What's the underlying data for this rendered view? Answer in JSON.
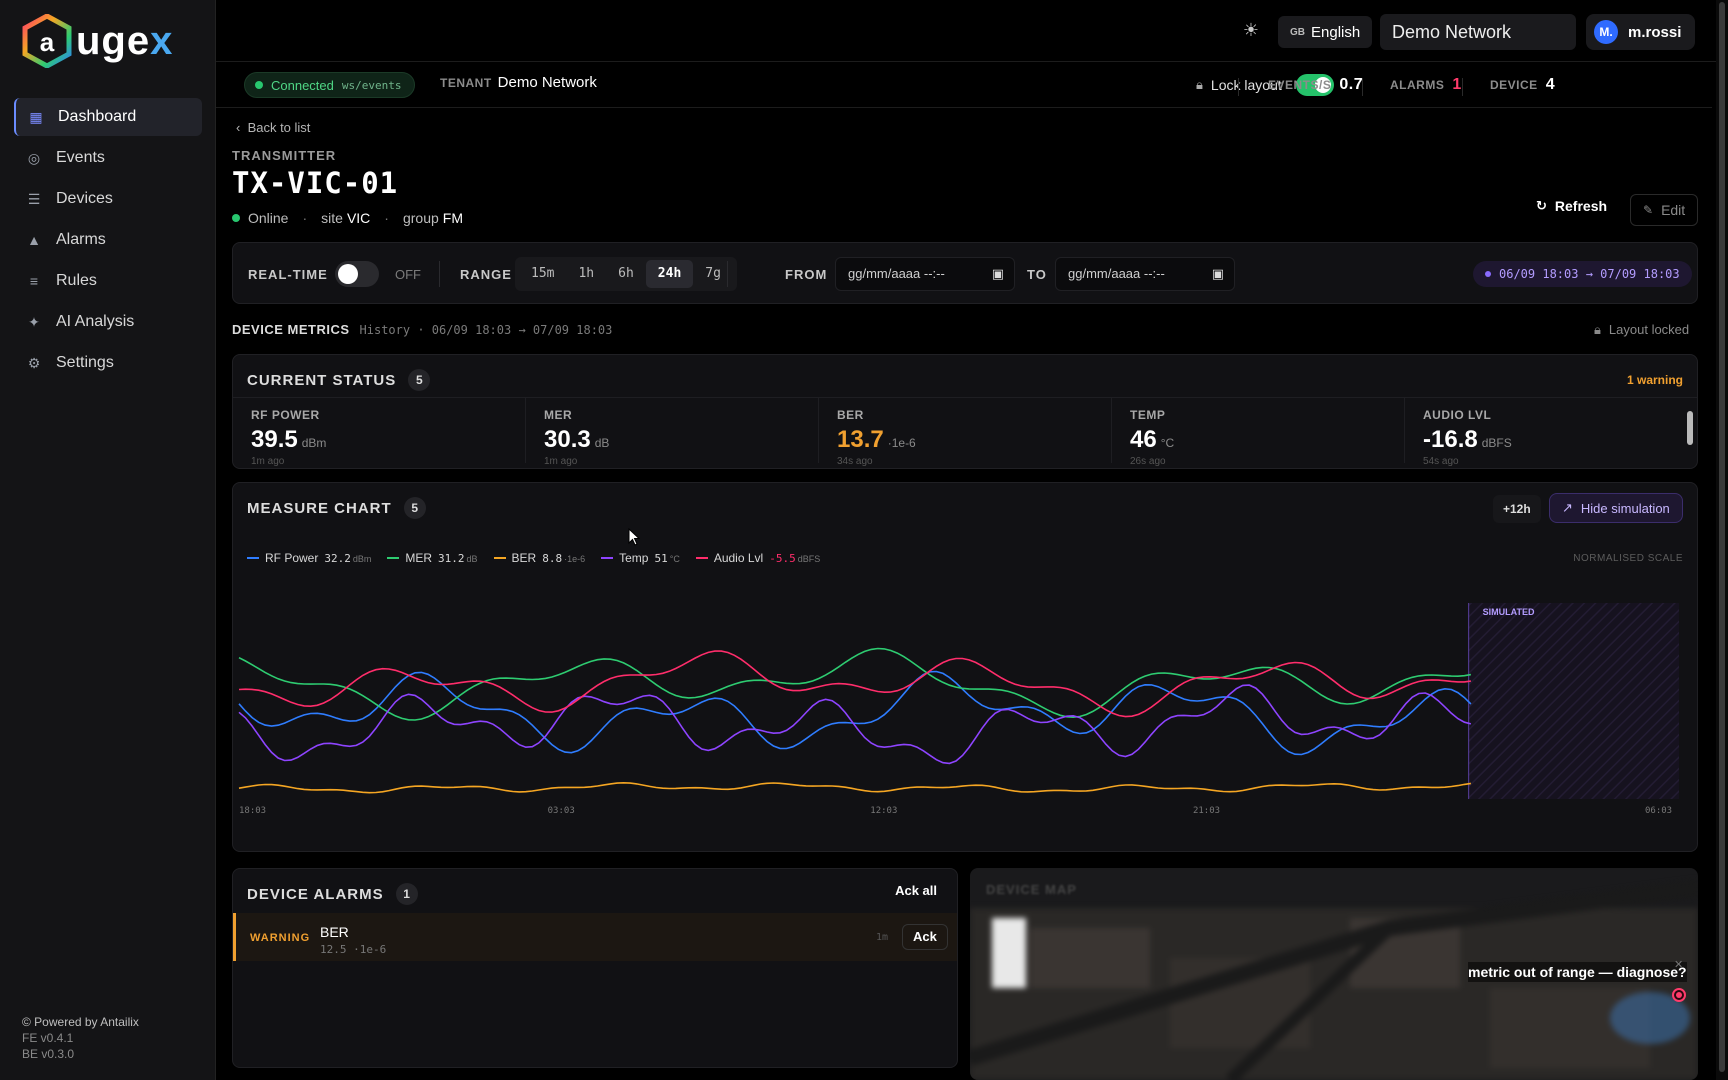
{
  "brand": {
    "logo_text": "augex"
  },
  "nav": [
    {
      "label": "Dashboard",
      "icon": "dashboard-icon",
      "active": true
    },
    {
      "label": "Events",
      "icon": "events-icon"
    },
    {
      "label": "Devices",
      "icon": "devices-icon"
    },
    {
      "label": "Alarms",
      "icon": "alarm-icon"
    },
    {
      "label": "Rules",
      "icon": "rules-icon"
    },
    {
      "label": "AI Analysis",
      "icon": "sparkle-icon"
    },
    {
      "label": "Settings",
      "icon": "gear-icon"
    }
  ],
  "footer": {
    "powered": "© Powered by Antailix",
    "fe": "FE v0.4.1",
    "be": "BE v0.3.0"
  },
  "topbar": {
    "lang_flag": "GB",
    "language": "English",
    "network": "Demo Network",
    "avatar": "M.",
    "user": "m.rossi"
  },
  "statusbar": {
    "conn_label": "Connected",
    "conn_endpoint": "ws/events",
    "tenant_label": "TENANT",
    "tenant_value": "Demo Network",
    "lock_label": "Lock layout",
    "lock_on": true,
    "events_label": "EVENTS/S",
    "events_value": "0.7",
    "alarms_label": "ALARMS",
    "alarms_value": "1",
    "device_label": "DEVICE",
    "device_value": "4"
  },
  "device": {
    "back": "Back to list",
    "type": "TRANSMITTER",
    "name": "TX-VIC-01",
    "status": "Online",
    "site_label": "site",
    "site": "VIC",
    "group_label": "group",
    "group": "FM",
    "refresh": "Refresh",
    "edit": "Edit"
  },
  "range": {
    "realtime_label": "REAL-TIME",
    "realtime_state": "OFF",
    "range_label": "RANGE",
    "options": [
      "15m",
      "1h",
      "6h",
      "24h",
      "7g"
    ],
    "selected": "24h",
    "from_label": "FROM",
    "from_placeholder": "gg/mm/aaaa --:--",
    "to_label": "TO",
    "to_placeholder": "gg/mm/aaaa --:--",
    "window": "06/09 18:03 → 07/09 18:03"
  },
  "metrics": {
    "title": "DEVICE METRICS",
    "history": "History · 06/09 18:03 → 07/09 18:03",
    "locked": "Layout locked"
  },
  "current_status": {
    "title": "CURRENT STATUS",
    "count": "5",
    "warning": "1 warning",
    "items": [
      {
        "label": "RF POWER",
        "value": "39.5",
        "unit": "dBm",
        "ago": "1m ago",
        "warn": false
      },
      {
        "label": "MER",
        "value": "30.3",
        "unit": "dB",
        "ago": "1m ago",
        "warn": false
      },
      {
        "label": "BER",
        "value": "13.7",
        "unit": "·1e-6",
        "ago": "34s ago",
        "warn": true
      },
      {
        "label": "TEMP",
        "value": "46",
        "unit": "°C",
        "ago": "26s ago",
        "warn": false
      },
      {
        "label": "AUDIO LVL",
        "value": "-16.8",
        "unit": "dBFS",
        "ago": "54s ago",
        "warn": false
      }
    ]
  },
  "measure_chart": {
    "title": "MEASURE CHART",
    "count": "5",
    "plus": "+12h",
    "hide_sim": "Hide simulation",
    "normalised": "NORMALISED SCALE",
    "simulated": "SIMULATED",
    "colors": {
      "rf": "#2f7dff",
      "mer": "#2ecc71",
      "ber": "#f5a623",
      "temp": "#8e44ff",
      "audio": "#ff2d6b"
    }
  },
  "chart_data": {
    "type": "line",
    "x_ticks": [
      "18:03",
      "03:03",
      "12:03",
      "21:03",
      "06:03"
    ],
    "series": [
      {
        "name": "RF Power",
        "current": "32.2",
        "unit": "dBm",
        "color": "#2f7dff"
      },
      {
        "name": "MER",
        "current": "31.2",
        "unit": "dB",
        "color": "#2ecc71"
      },
      {
        "name": "BER",
        "current": "8.8",
        "unit": "·1e-6",
        "color": "#f5a623"
      },
      {
        "name": "Temp",
        "current": "51",
        "unit": "°C",
        "color": "#8e44ff"
      },
      {
        "name": "Audio Lvl",
        "current": "-5.5",
        "unit": "dBFS",
        "color": "#ff2d6b"
      }
    ],
    "simulated_from": "21:03"
  },
  "alarms": {
    "title": "DEVICE ALARMS",
    "count": "1",
    "ack_all": "Ack all",
    "rows": [
      {
        "severity": "WARNING",
        "metric": "BER",
        "value": "12.5 ·1e-6",
        "age": "1m",
        "ack": "Ack"
      }
    ]
  },
  "map": {
    "title": "DEVICE MAP",
    "tooltip": "metric out of range — diagnose?"
  }
}
